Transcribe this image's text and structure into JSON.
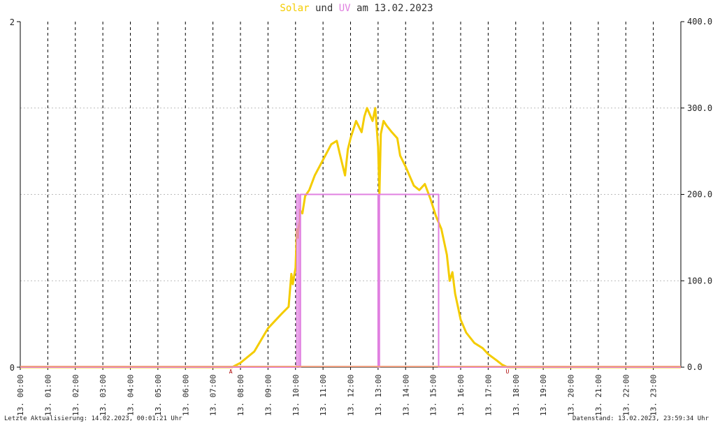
{
  "title": {
    "solar": "Solar",
    "und": "und",
    "uv": "UV",
    "am": "am",
    "date": "13.02.2023"
  },
  "footer": {
    "left": "Letzte Aktualisierung: 14.02.2023, 00:01:21 Uhr",
    "right": "Datenstand: 13.02.2023, 23:59:34 Uhr"
  },
  "colors": {
    "solar": "#f4cc00",
    "uv": "#e080e0",
    "baseline": "#f0a080",
    "axis": "#000000",
    "grid": "#000000",
    "hgrid": "#bbbbbb",
    "marker": "#aa0000"
  },
  "chart_data": {
    "type": "line",
    "x_unit": "hour",
    "xlim": [
      0,
      24
    ],
    "y_left_lim": [
      0,
      2
    ],
    "y_left_ticks": [
      "0",
      "2"
    ],
    "y_right_lim": [
      0,
      400
    ],
    "y_right_ticks": [
      "0.0",
      "100.0",
      "200.0",
      "300.0",
      "400.0"
    ],
    "x_tick_labels": [
      "13. 00:00",
      "13. 01:00",
      "13. 02:00",
      "13. 03:00",
      "13. 04:00",
      "13. 05:00",
      "13. 06:00",
      "13. 07:00",
      "13. 08:00",
      "13. 09:00",
      "13. 10:00",
      "13. 11:00",
      "13. 12:00",
      "13. 13:00",
      "13. 14:00",
      "13. 15:00",
      "13. 16:00",
      "13. 17:00",
      "13. 18:00",
      "13. 19:00",
      "13. 20:00",
      "13. 21:00",
      "13. 22:00",
      "13. 23:00"
    ],
    "grid": true,
    "markers": [
      {
        "label": "A",
        "x": 7.65
      },
      {
        "label": "U",
        "x": 17.7
      }
    ],
    "series": [
      {
        "name": "Solar",
        "axis": "right",
        "x": [
          0,
          7.7,
          8.0,
          8.5,
          9.0,
          9.5,
          9.75,
          9.85,
          9.9,
          10.0,
          10.05,
          10.1,
          10.15,
          10.25,
          10.35,
          10.5,
          10.7,
          11.0,
          11.3,
          11.5,
          11.6,
          11.8,
          11.9,
          12.0,
          12.2,
          12.4,
          12.5,
          12.6,
          12.8,
          12.9,
          13.0,
          13.05,
          13.1,
          13.2,
          13.3,
          13.5,
          13.7,
          13.8,
          14.0,
          14.3,
          14.5,
          14.7,
          14.9,
          15.0,
          15.1,
          15.3,
          15.5,
          15.6,
          15.7,
          15.8,
          15.9,
          16.0,
          16.2,
          16.5,
          16.8,
          17.0,
          17.3,
          17.5,
          17.7,
          24
        ],
        "values": [
          0,
          0,
          5,
          18,
          45,
          62,
          70,
          108,
          96,
          115,
          160,
          150,
          182,
          178,
          198,
          205,
          222,
          240,
          258,
          262,
          248,
          222,
          252,
          265,
          285,
          272,
          290,
          300,
          285,
          300,
          255,
          200,
          270,
          285,
          280,
          272,
          265,
          245,
          232,
          210,
          205,
          212,
          195,
          185,
          175,
          160,
          130,
          100,
          110,
          85,
          70,
          55,
          40,
          28,
          22,
          15,
          8,
          3,
          0,
          0
        ]
      },
      {
        "name": "UV",
        "axis": "left",
        "x": [
          0,
          10.05,
          10.05,
          10.12,
          10.12,
          10.18,
          10.18,
          10.25,
          10.25,
          13.0,
          13.0,
          13.05,
          13.05,
          15.2,
          15.2,
          24
        ],
        "values": [
          0,
          0,
          1,
          1,
          0,
          0,
          1,
          1,
          1,
          1,
          0,
          0,
          1,
          1,
          0,
          0
        ]
      }
    ]
  }
}
